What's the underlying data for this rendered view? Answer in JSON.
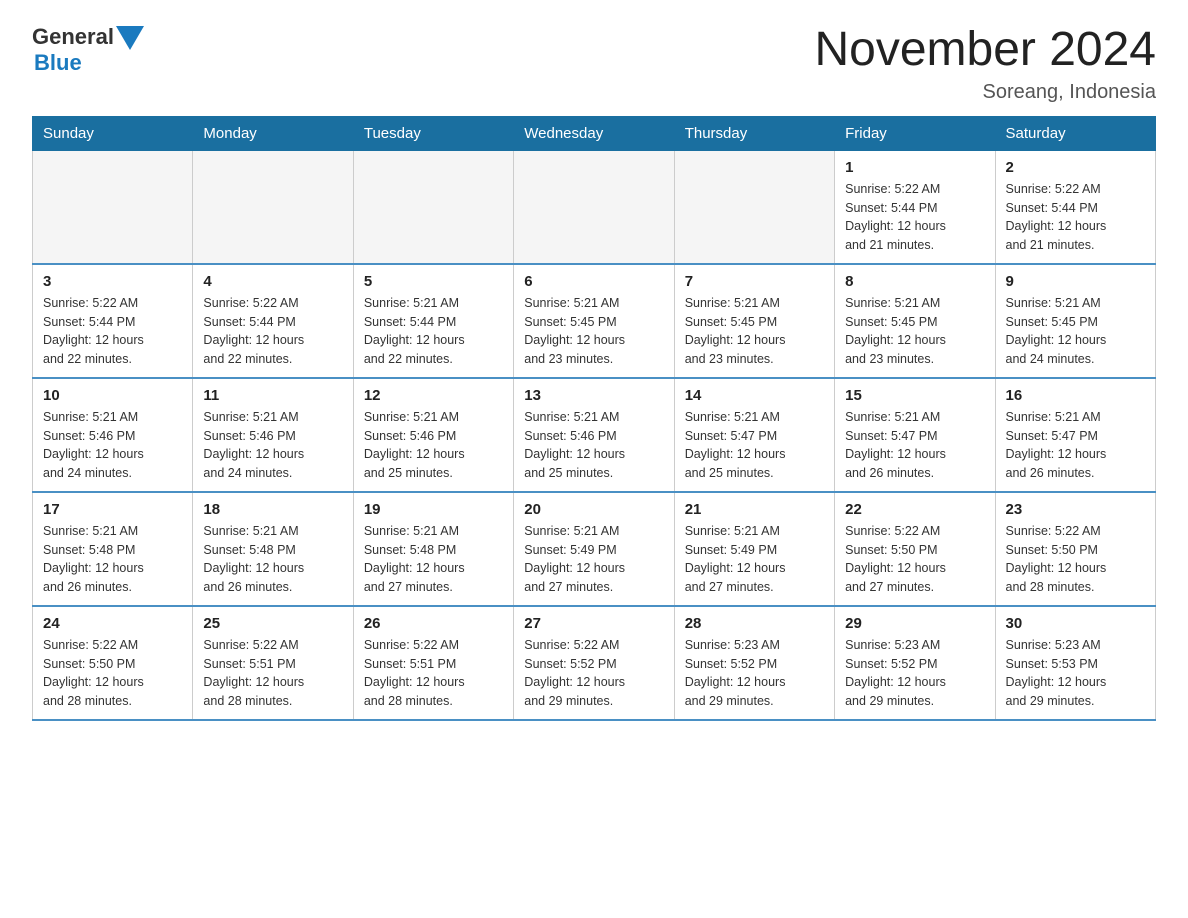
{
  "logo": {
    "general": "General",
    "blue": "Blue"
  },
  "title": "November 2024",
  "location": "Soreang, Indonesia",
  "days_of_week": [
    "Sunday",
    "Monday",
    "Tuesday",
    "Wednesday",
    "Thursday",
    "Friday",
    "Saturday"
  ],
  "weeks": [
    [
      {
        "day": "",
        "info": ""
      },
      {
        "day": "",
        "info": ""
      },
      {
        "day": "",
        "info": ""
      },
      {
        "day": "",
        "info": ""
      },
      {
        "day": "",
        "info": ""
      },
      {
        "day": "1",
        "info": "Sunrise: 5:22 AM\nSunset: 5:44 PM\nDaylight: 12 hours\nand 21 minutes."
      },
      {
        "day": "2",
        "info": "Sunrise: 5:22 AM\nSunset: 5:44 PM\nDaylight: 12 hours\nand 21 minutes."
      }
    ],
    [
      {
        "day": "3",
        "info": "Sunrise: 5:22 AM\nSunset: 5:44 PM\nDaylight: 12 hours\nand 22 minutes."
      },
      {
        "day": "4",
        "info": "Sunrise: 5:22 AM\nSunset: 5:44 PM\nDaylight: 12 hours\nand 22 minutes."
      },
      {
        "day": "5",
        "info": "Sunrise: 5:21 AM\nSunset: 5:44 PM\nDaylight: 12 hours\nand 22 minutes."
      },
      {
        "day": "6",
        "info": "Sunrise: 5:21 AM\nSunset: 5:45 PM\nDaylight: 12 hours\nand 23 minutes."
      },
      {
        "day": "7",
        "info": "Sunrise: 5:21 AM\nSunset: 5:45 PM\nDaylight: 12 hours\nand 23 minutes."
      },
      {
        "day": "8",
        "info": "Sunrise: 5:21 AM\nSunset: 5:45 PM\nDaylight: 12 hours\nand 23 minutes."
      },
      {
        "day": "9",
        "info": "Sunrise: 5:21 AM\nSunset: 5:45 PM\nDaylight: 12 hours\nand 24 minutes."
      }
    ],
    [
      {
        "day": "10",
        "info": "Sunrise: 5:21 AM\nSunset: 5:46 PM\nDaylight: 12 hours\nand 24 minutes."
      },
      {
        "day": "11",
        "info": "Sunrise: 5:21 AM\nSunset: 5:46 PM\nDaylight: 12 hours\nand 24 minutes."
      },
      {
        "day": "12",
        "info": "Sunrise: 5:21 AM\nSunset: 5:46 PM\nDaylight: 12 hours\nand 25 minutes."
      },
      {
        "day": "13",
        "info": "Sunrise: 5:21 AM\nSunset: 5:46 PM\nDaylight: 12 hours\nand 25 minutes."
      },
      {
        "day": "14",
        "info": "Sunrise: 5:21 AM\nSunset: 5:47 PM\nDaylight: 12 hours\nand 25 minutes."
      },
      {
        "day": "15",
        "info": "Sunrise: 5:21 AM\nSunset: 5:47 PM\nDaylight: 12 hours\nand 26 minutes."
      },
      {
        "day": "16",
        "info": "Sunrise: 5:21 AM\nSunset: 5:47 PM\nDaylight: 12 hours\nand 26 minutes."
      }
    ],
    [
      {
        "day": "17",
        "info": "Sunrise: 5:21 AM\nSunset: 5:48 PM\nDaylight: 12 hours\nand 26 minutes."
      },
      {
        "day": "18",
        "info": "Sunrise: 5:21 AM\nSunset: 5:48 PM\nDaylight: 12 hours\nand 26 minutes."
      },
      {
        "day": "19",
        "info": "Sunrise: 5:21 AM\nSunset: 5:48 PM\nDaylight: 12 hours\nand 27 minutes."
      },
      {
        "day": "20",
        "info": "Sunrise: 5:21 AM\nSunset: 5:49 PM\nDaylight: 12 hours\nand 27 minutes."
      },
      {
        "day": "21",
        "info": "Sunrise: 5:21 AM\nSunset: 5:49 PM\nDaylight: 12 hours\nand 27 minutes."
      },
      {
        "day": "22",
        "info": "Sunrise: 5:22 AM\nSunset: 5:50 PM\nDaylight: 12 hours\nand 27 minutes."
      },
      {
        "day": "23",
        "info": "Sunrise: 5:22 AM\nSunset: 5:50 PM\nDaylight: 12 hours\nand 28 minutes."
      }
    ],
    [
      {
        "day": "24",
        "info": "Sunrise: 5:22 AM\nSunset: 5:50 PM\nDaylight: 12 hours\nand 28 minutes."
      },
      {
        "day": "25",
        "info": "Sunrise: 5:22 AM\nSunset: 5:51 PM\nDaylight: 12 hours\nand 28 minutes."
      },
      {
        "day": "26",
        "info": "Sunrise: 5:22 AM\nSunset: 5:51 PM\nDaylight: 12 hours\nand 28 minutes."
      },
      {
        "day": "27",
        "info": "Sunrise: 5:22 AM\nSunset: 5:52 PM\nDaylight: 12 hours\nand 29 minutes."
      },
      {
        "day": "28",
        "info": "Sunrise: 5:23 AM\nSunset: 5:52 PM\nDaylight: 12 hours\nand 29 minutes."
      },
      {
        "day": "29",
        "info": "Sunrise: 5:23 AM\nSunset: 5:52 PM\nDaylight: 12 hours\nand 29 minutes."
      },
      {
        "day": "30",
        "info": "Sunrise: 5:23 AM\nSunset: 5:53 PM\nDaylight: 12 hours\nand 29 minutes."
      }
    ]
  ]
}
